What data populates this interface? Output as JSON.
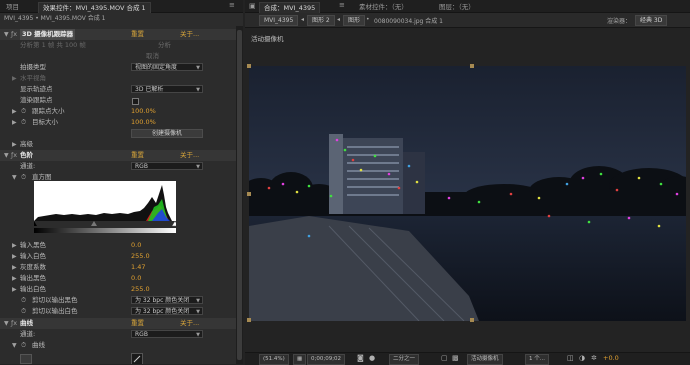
{
  "left_tabs": {
    "project": "项目",
    "effect_controls": "效果控件：MVI_4395.MOV 合成 1",
    "menu": "≡"
  },
  "breadcrumb": "MVI_4395 • MVI_4395.MOV 合成 1",
  "tracker": {
    "name": "3D 摄像机跟踪器",
    "reset": "重置",
    "about": "关于...",
    "analyze": "分析",
    "cancel": "取消",
    "status": "分析第 1 帧 共 100 帧",
    "shot_type_label": "拍摄类型",
    "shot_type_value": "视图的固定角度",
    "horizontal_fov": "水平视角",
    "show_track_points_label": "显示轨迹点",
    "show_track_points_value": "3D 已解析",
    "render_track_points_label": "渲染跟踪点",
    "track_point_size_label": "跟踪点大小",
    "track_point_size_value": "100.0%",
    "target_size_label": "目标大小",
    "target_size_value": "100.0%",
    "create_camera": "创建摄像机",
    "advanced": "高级"
  },
  "levels": {
    "name": "色阶",
    "reset": "重置",
    "about": "关于...",
    "channel_label": "通道:",
    "channel_value": "RGB",
    "histogram_label": "直方图",
    "input_black_label": "输入黑色",
    "input_black_value": "0.0",
    "input_white_label": "输入白色",
    "input_white_value": "255.0",
    "gamma_label": "灰度系数",
    "gamma_value": "1.47",
    "output_black_label": "输出黑色",
    "output_black_value": "0.0",
    "output_white_label": "输出白色",
    "output_white_value": "255.0",
    "clip_black_label": "剪切以输出黑色",
    "clip_black_value": "为 32 bpc 颜色关闭",
    "clip_white_label": "剪切以输出白色",
    "clip_white_value": "为 32 bpc 颜色关闭"
  },
  "curves": {
    "name": "曲线",
    "reset": "重置",
    "about": "关于...",
    "channel_label": "通道:",
    "channel_value": "RGB",
    "curves_label": "曲线"
  },
  "right_tabs": {
    "comp": "合成：MVI_4395",
    "menu": "≡",
    "footage": "素材控件：（无）",
    "layer": "图层：（无）"
  },
  "comp_toolbar": {
    "comp_chip": "MVI_4395",
    "layer_chip": "图形 2",
    "graph": "图形",
    "breadcrumb": "0080090034.jpg 合成 1",
    "renderer_label": "渲染器：",
    "renderer_value": "经典 3D"
  },
  "viewer_label": "活动摄像机",
  "bottom": {
    "zoom": "(51.4%)",
    "timecode": "0;00;09;02",
    "quality": "二分之一",
    "view": "活动摄像机",
    "views": "1 个...",
    "exposure": "+0.0"
  },
  "colors": {
    "accent": "#e0a030",
    "link": "#d9a63a"
  }
}
